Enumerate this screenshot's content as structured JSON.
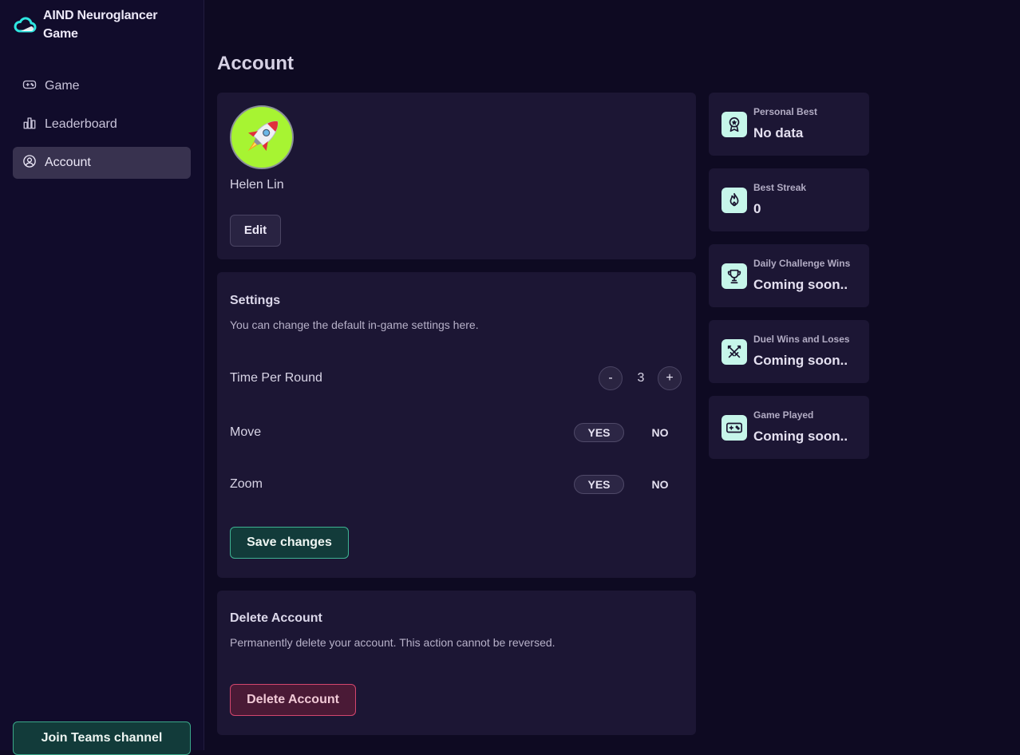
{
  "app": {
    "title": "AIND Neuroglancer Game",
    "logo_icon": "cloud-icon"
  },
  "sidebar": {
    "items": [
      {
        "label": "Game",
        "icon": "gamepad-icon",
        "active": false
      },
      {
        "label": "Leaderboard",
        "icon": "bar-chart-icon",
        "active": false
      },
      {
        "label": "Account",
        "icon": "user-circle-icon",
        "active": true
      }
    ],
    "teams_button": "Join Teams channel"
  },
  "page": {
    "title": "Account"
  },
  "profile": {
    "avatar_icon": "rocket-icon",
    "name": "Helen Lin",
    "edit_label": "Edit"
  },
  "settings": {
    "title": "Settings",
    "description": "You can change the default in-game settings here.",
    "time_per_round": {
      "label": "Time Per Round",
      "value": "3",
      "minus": "-",
      "plus": "+"
    },
    "move": {
      "label": "Move",
      "yes": "YES",
      "no": "NO",
      "selected": "YES"
    },
    "zoom": {
      "label": "Zoom",
      "yes": "YES",
      "no": "NO",
      "selected": "YES"
    },
    "save_label": "Save changes"
  },
  "delete_account": {
    "title": "Delete Account",
    "description": "Permanently delete your account. This action cannot be reversed.",
    "button_label": "Delete Account"
  },
  "stats": [
    {
      "label": "Personal Best",
      "value": "No data",
      "icon": "award-icon"
    },
    {
      "label": "Best Streak",
      "value": "0",
      "icon": "flame-icon"
    },
    {
      "label": "Daily Challenge Wins",
      "value": "Coming soon..",
      "icon": "trophy-icon"
    },
    {
      "label": "Duel Wins and Loses",
      "value": "Coming soon..",
      "icon": "swords-icon"
    },
    {
      "label": "Game Played",
      "value": "Coming soon..",
      "icon": "gamepad-icon"
    }
  ],
  "colors": {
    "background": "#0e0a22",
    "sidebar": "#110c2b",
    "card": "#1c1634",
    "accent_green": "#3fb393",
    "danger": "#d3466e",
    "icon_bg": "#c6f6ea",
    "logo": "#2ee6e0"
  }
}
